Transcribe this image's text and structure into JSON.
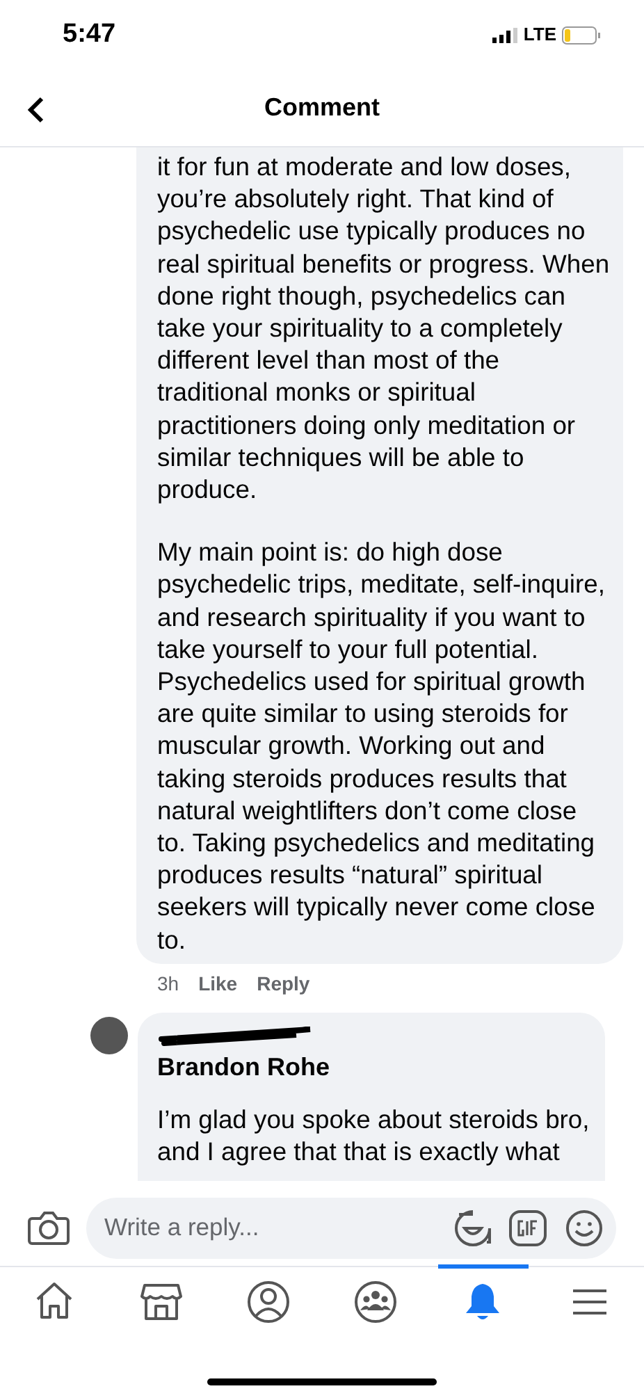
{
  "status_bar": {
    "time": "5:47",
    "network": "LTE"
  },
  "header": {
    "title": "Comment"
  },
  "comment": {
    "paragraphs": [
      "it for fun at moderate and low doses, you’re absolutely right. That kind of psychedelic use typically produces no real spiritual benefits or progress. When done right though, psychedelics can take your spirituality to a completely different level than most of the traditional monks or spiritual practitioners doing only meditation or similar techniques will be able to produce.",
      "My main point is: do high dose psychedelic trips, meditate, self-inquire, and research spirituality if you want to take yourself to your full potential. Psychedelics used for spiritual growth are quite similar to using steroids for muscular growth. Working out and taking steroids produces results that natural weightlifters don’t come close to. Taking psychedelics and meditating produces results “natural” spiritual seekers will typically never come close to."
    ],
    "time": "3h",
    "actions": [
      "Like",
      "Reply"
    ]
  },
  "reply": {
    "name_redacted": true,
    "tagged_name": "Brandon Rohe",
    "text": "I’m glad you spoke about steroids bro, and I agree that that is exactly what"
  },
  "composer": {
    "placeholder": "Write a reply..."
  },
  "nav_tabs": [
    {
      "kind": "home",
      "selected": false
    },
    {
      "kind": "marketplace",
      "selected": false
    },
    {
      "kind": "profile",
      "selected": false
    },
    {
      "kind": "groups",
      "selected": false
    },
    {
      "kind": "notifications",
      "selected": true
    },
    {
      "kind": "menu",
      "selected": false
    }
  ]
}
